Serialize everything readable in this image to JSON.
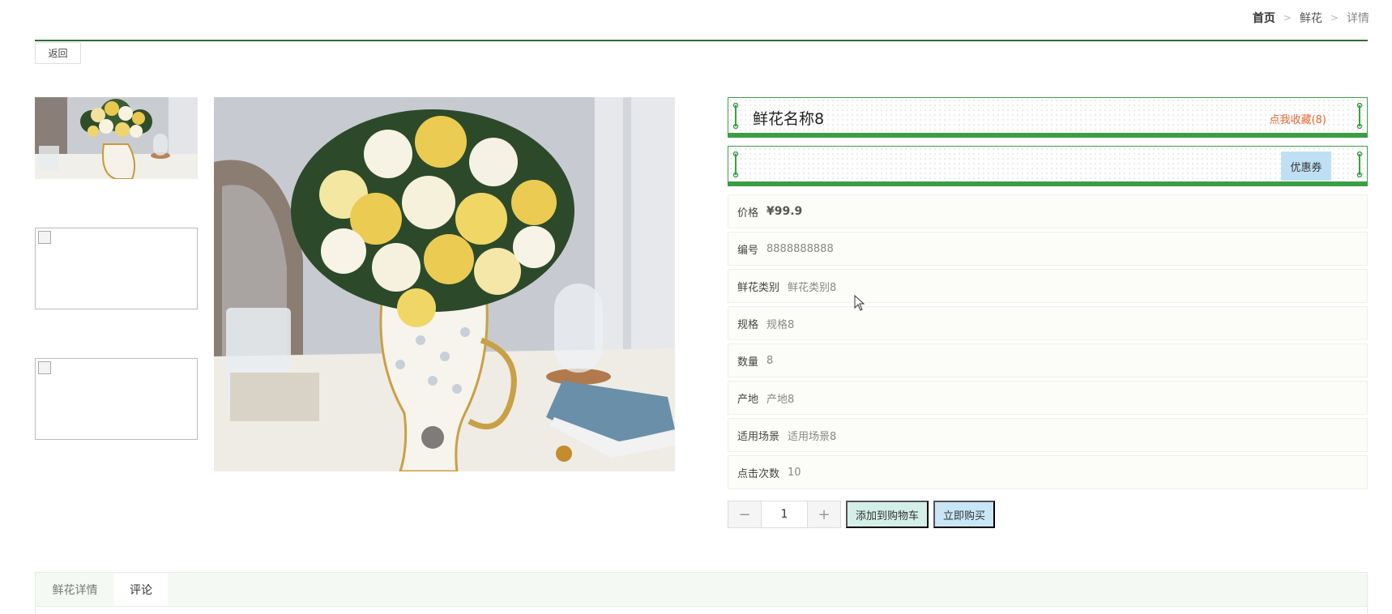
{
  "breadcrumb": {
    "home": "首页",
    "sep": ">",
    "category": "鲜花",
    "current": "详情"
  },
  "back_label": "返回",
  "product": {
    "name": "鲜花名称8",
    "favorite_label": "点我收藏(8)",
    "coupon_label": "优惠券",
    "info": [
      {
        "key": "价格",
        "value": "¥99.9"
      },
      {
        "key": "编号",
        "value": "8888888888"
      },
      {
        "key": "鲜花类别",
        "value": "鲜花类别8"
      },
      {
        "key": "规格",
        "value": "规格8"
      },
      {
        "key": "数量",
        "value": "8"
      },
      {
        "key": "产地",
        "value": "产地8"
      },
      {
        "key": "适用场景",
        "value": "适用场景8"
      },
      {
        "key": "点击次数",
        "value": "10"
      }
    ]
  },
  "purchase": {
    "minus": "−",
    "quantity": "1",
    "plus": "+",
    "add_to_cart": "添加到购物车",
    "buy_now": "立即购买"
  },
  "tabs": [
    {
      "label": "鲜花详情"
    },
    {
      "label": "评论"
    }
  ],
  "colors": {
    "accent_green": "#3b9e45",
    "favorite": "#e2662d",
    "coupon_bg": "#bfe0f4",
    "cart_bg": "#d4efe7",
    "buy_bg": "#c9e6f7"
  }
}
